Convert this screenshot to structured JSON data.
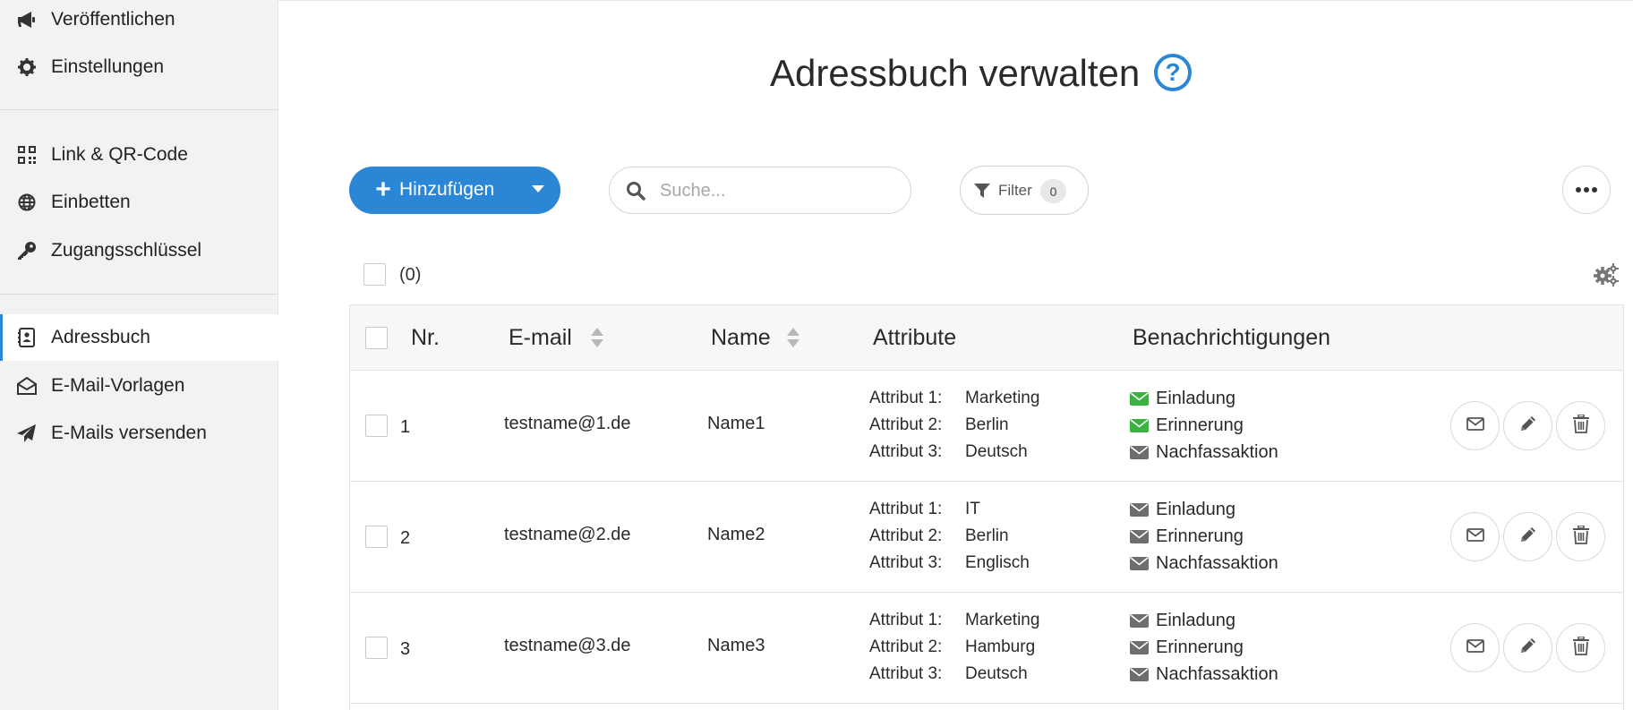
{
  "sidebar": {
    "group1": [
      {
        "label": "Veröffentlichen",
        "icon": "megaphone-icon"
      },
      {
        "label": "Einstellungen",
        "icon": "gear-icon"
      }
    ],
    "group2": [
      {
        "label": "Link & QR-Code",
        "icon": "qr-code-icon"
      },
      {
        "label": "Einbetten",
        "icon": "globe-icon"
      },
      {
        "label": "Zugangsschlüssel",
        "icon": "key-icon"
      }
    ],
    "group3": [
      {
        "label": "Adressbuch",
        "icon": "address-book-icon",
        "active": true
      },
      {
        "label": "E-Mail-Vorlagen",
        "icon": "envelope-open-icon"
      },
      {
        "label": "E-Mails versenden",
        "icon": "paper-plane-icon"
      }
    ]
  },
  "page": {
    "title": "Adressbuch verwalten",
    "help_symbol": "?"
  },
  "toolbar": {
    "add_label": "Hinzufügen",
    "search_placeholder": "Suche...",
    "filter_label": "Filter",
    "filter_count": "0"
  },
  "selection": {
    "count_label": "(0)"
  },
  "table": {
    "headers": {
      "nr": "Nr.",
      "email": "E-mail",
      "name": "Name",
      "attribute": "Attribute",
      "notifications": "Benachrichtigungen"
    },
    "rows": [
      {
        "nr": "1",
        "email": "testname@1.de",
        "name": "Name1",
        "attributes": [
          {
            "key": "Attribut 1:",
            "value": "Marketing"
          },
          {
            "key": "Attribut 2:",
            "value": "Berlin"
          },
          {
            "key": "Attribut 3:",
            "value": "Deutsch"
          }
        ],
        "notifications": [
          {
            "label": "Einladung",
            "sent": true
          },
          {
            "label": "Erinnerung",
            "sent": true
          },
          {
            "label": "Nachfassaktion",
            "sent": false
          }
        ]
      },
      {
        "nr": "2",
        "email": "testname@2.de",
        "name": "Name2",
        "attributes": [
          {
            "key": "Attribut 1:",
            "value": "IT"
          },
          {
            "key": "Attribut 2:",
            "value": "Berlin"
          },
          {
            "key": "Attribut 3:",
            "value": "Englisch"
          }
        ],
        "notifications": [
          {
            "label": "Einladung",
            "sent": false
          },
          {
            "label": "Erinnerung",
            "sent": false
          },
          {
            "label": "Nachfassaktion",
            "sent": false
          }
        ]
      },
      {
        "nr": "3",
        "email": "testname@3.de",
        "name": "Name3",
        "attributes": [
          {
            "key": "Attribut 1:",
            "value": "Marketing"
          },
          {
            "key": "Attribut 2:",
            "value": "Hamburg"
          },
          {
            "key": "Attribut 3:",
            "value": "Deutsch"
          }
        ],
        "notifications": [
          {
            "label": "Einladung",
            "sent": false
          },
          {
            "label": "Erinnerung",
            "sent": false
          },
          {
            "label": "Nachfassaktion",
            "sent": false
          }
        ]
      }
    ]
  },
  "colors": {
    "accent": "#2b87d6",
    "sent": "#3cb043",
    "unsent": "#6e6e6e",
    "sidebar_bg": "#f2f2f2"
  }
}
